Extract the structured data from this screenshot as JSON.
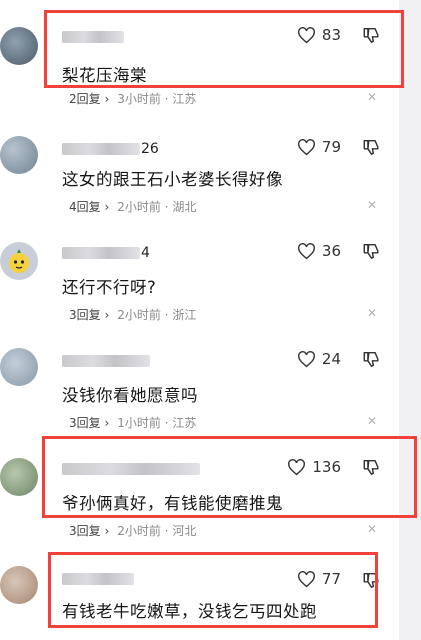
{
  "comments": [
    {
      "username_suffix": "",
      "likes": "83",
      "text": "梨花压海棠",
      "replies": "2回复",
      "time": "3小时前",
      "location": "江苏"
    },
    {
      "username_suffix": "26",
      "likes": "79",
      "text": "这女的跟王石小老婆长得好像",
      "replies": "4回复",
      "time": "2小时前",
      "location": "湖北"
    },
    {
      "username_suffix": "4",
      "likes": "36",
      "text": "还行不行呀?",
      "replies": "3回复",
      "time": "2小时前",
      "location": "浙江"
    },
    {
      "username_suffix": "",
      "likes": "24",
      "text": "没钱你看她愿意吗",
      "replies": "3回复",
      "time": "1小时前",
      "location": "江苏"
    },
    {
      "username_suffix": "",
      "likes": "136",
      "text": "爷孙俩真好，有钱能使磨推鬼",
      "replies": "3回复",
      "time": "2小时前",
      "location": "河北"
    },
    {
      "username_suffix": "",
      "likes": "77",
      "text": "有钱老牛吃嫩草，没钱乞丐四处跑",
      "replies": "",
      "time": "",
      "location": ""
    }
  ],
  "icons": {
    "like": "heart-outline-icon",
    "dislike": "thumbs-down-icon",
    "close": "close-icon",
    "chevron": "chevron-right-icon"
  },
  "colors": {
    "highlight": "#f0413a"
  },
  "separators": {
    "dot": "·",
    "chevron": "›",
    "close": "✕"
  }
}
